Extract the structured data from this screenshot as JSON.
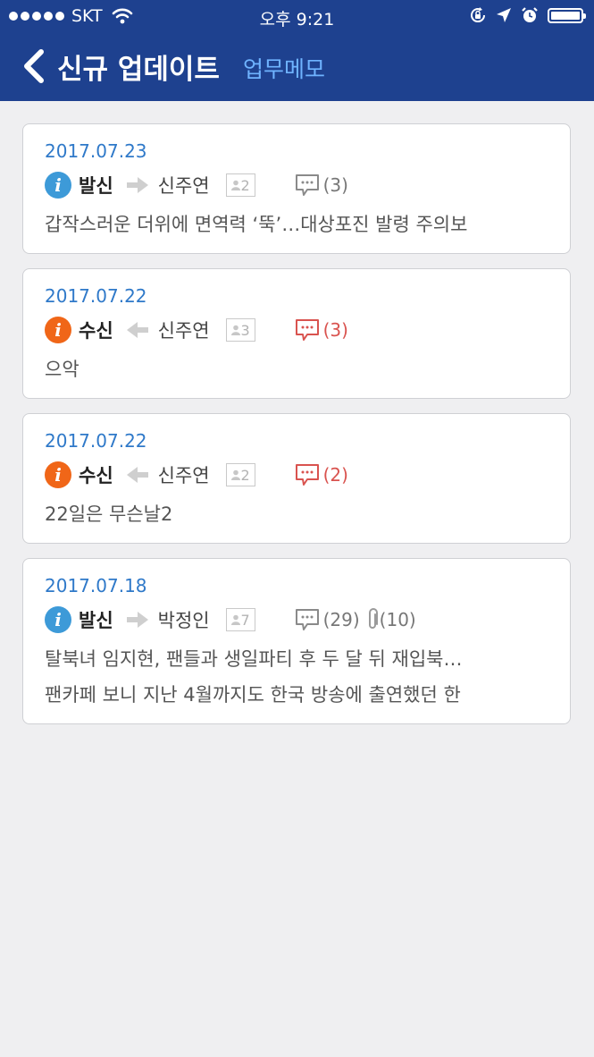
{
  "status": {
    "carrier": "SKT",
    "time": "오후 9:21"
  },
  "nav": {
    "title": "신규 업데이트",
    "subtitle": "업무메모"
  },
  "colors": {
    "header_bg": "#1e418f",
    "sent_badge": "#3d9ad8",
    "received_badge": "#f06618",
    "date_text": "#2f79c9",
    "unread_comment": "#d9534f"
  },
  "memos": [
    {
      "date": "2017.07.23",
      "kind": "발신",
      "direction": "sent",
      "person": "신주연",
      "count": "2",
      "comments": "(3)",
      "comments_unread": false,
      "attachments": "",
      "lines": [
        "갑작스러운 더위에 면역력 ‘뚝’…대상포진 발령 주의보"
      ]
    },
    {
      "date": "2017.07.22",
      "kind": "수신",
      "direction": "received",
      "person": "신주연",
      "count": "3",
      "comments": "(3)",
      "comments_unread": true,
      "attachments": "",
      "lines": [
        "으악"
      ]
    },
    {
      "date": "2017.07.22",
      "kind": "수신",
      "direction": "received",
      "person": "신주연",
      "count": "2",
      "comments": "(2)",
      "comments_unread": true,
      "attachments": "",
      "lines": [
        "22일은 무슨날2"
      ]
    },
    {
      "date": "2017.07.18",
      "kind": "발신",
      "direction": "sent",
      "person": "박정인",
      "count": "7",
      "comments": "(29)",
      "comments_unread": false,
      "attachments": "(10)",
      "lines": [
        "탈북녀 임지현, 팬들과 생일파티 후 두 달 뒤 재입북…",
        "팬카페 보니 지난 4월까지도 한국 방송에 출연했던 한"
      ]
    }
  ]
}
